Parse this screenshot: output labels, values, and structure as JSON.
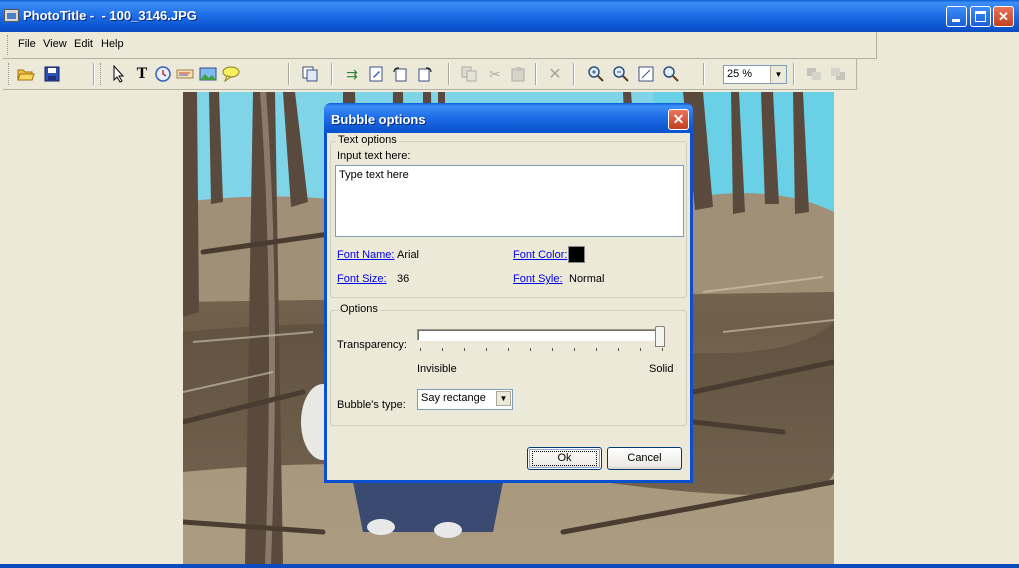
{
  "window": {
    "title": "PhotoTitle -  - 100_3146.JPG"
  },
  "menu": [
    "File",
    "View",
    "Edit",
    "Help"
  ],
  "toolbar": {
    "zoom_value": "25 %",
    "icons": [
      "open-folder-icon",
      "save-disk-icon",
      "select-arrow-icon",
      "text-tool-icon",
      "clock-icon",
      "marker-icon",
      "picture-icon",
      "speech-bubble-icon",
      "copy-pages-icon",
      "add-item-icon",
      "edit-item-icon",
      "rotate-left-icon",
      "rotate-right-icon",
      "copy-icon",
      "cut-icon",
      "paste-icon",
      "delete-icon",
      "zoom-in-icon",
      "zoom-out-icon",
      "fit-window-icon",
      "actual-size-icon",
      "bring-forward-icon",
      "send-backward-icon"
    ]
  },
  "dialog": {
    "title": "Bubble options",
    "text_group": {
      "legend": "Text options",
      "input_label": "Input text here:",
      "input_value": "Type text here",
      "font_name_label": "Font Name:",
      "font_name_value": "Arial",
      "font_color_label": "Font Color:",
      "font_color_value": "#000000",
      "font_size_label": "Font Size:",
      "font_size_value": "36",
      "font_style_label": "Font Syle:",
      "font_style_value": "Normal"
    },
    "options_group": {
      "legend": "Options",
      "transparency_label": "Transparency:",
      "transparency_value": 1.0,
      "min_label": "Invisible",
      "max_label": "Solid",
      "bubble_type_label": "Bubble's type:",
      "bubble_type_value": "Say rectange"
    },
    "ok_label": "Ok",
    "cancel_label": "Cancel"
  }
}
